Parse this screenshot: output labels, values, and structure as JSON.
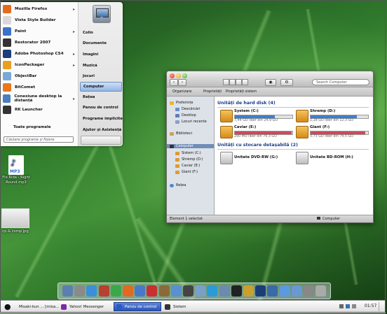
{
  "start_menu": {
    "programs": [
      {
        "label": "Mozilla Firefox",
        "icon": "firefox-icon",
        "color": "#e66a1e",
        "arrow": true
      },
      {
        "label": "Vista Style Builder",
        "icon": "builder-icon",
        "color": "#d9d9d9",
        "arrow": false
      },
      {
        "label": "Paint",
        "icon": "paint-icon",
        "color": "#3a74c9",
        "arrow": true
      },
      {
        "label": "Restorator 2007",
        "icon": "restorator-icon",
        "color": "#333333",
        "arrow": false
      },
      {
        "label": "Adobe Photoshop CS4",
        "icon": "photoshop-icon",
        "color": "#1b3e7a",
        "arrow": true
      },
      {
        "label": "IconPackager",
        "icon": "iconpackager-icon",
        "color": "#e8a020",
        "arrow": true
      },
      {
        "label": "ObjectBar",
        "icon": "objectbar-icon",
        "color": "#7aa8d8",
        "arrow": false
      },
      {
        "label": "BitComet",
        "icon": "bitcomet-icon",
        "color": "#e8781e",
        "arrow": false
      },
      {
        "label": "Conexiune desktop la distanță",
        "icon": "remote-desktop-icon",
        "color": "#4a7fc0",
        "arrow": true
      },
      {
        "label": "RK Launcher",
        "icon": "rklauncher-icon",
        "color": "#333333",
        "arrow": false
      }
    ],
    "all_programs": "Toate programele",
    "search_placeholder": "Căutare programe și fișiere",
    "right_items": [
      "Colin",
      "Documente",
      "Imagini",
      "Muzică",
      "Jocuri",
      "Computer",
      "Rețea",
      "Panou de control",
      "Programe implicite",
      "Ajutor și Asistență"
    ],
    "selected_right": "Computer"
  },
  "explorer": {
    "search_placeholder": "Search Computer",
    "commands": [
      "Organizare",
      "Proprietăți",
      "Proprietăți sistem"
    ],
    "sidebar": {
      "favorites": "Preferințe",
      "favorites_items": [
        "Descărcări",
        "Desktop",
        "Locuri recente"
      ],
      "libraries": "Biblioteci",
      "computer": "Computer",
      "computer_items": [
        "Sistem (C:)",
        "Shremp (D:)",
        "Caviar (E:)",
        "Giant (F:)"
      ],
      "network": "Rețea"
    },
    "hard_disks_header": "Unități de hard disk (4)",
    "drives": [
      {
        "name": "System (C:)",
        "free": "7,44 GO liber din 24,9 GO",
        "used_fraction": 0.7,
        "fill": "#3a7fd0"
      },
      {
        "name": "Shremp (D:)",
        "free": "2,28 GO liber din 12,3 GO",
        "used_fraction": 0.81,
        "fill": "#3a7fd0"
      },
      {
        "name": "Caviar (E:)",
        "free": "290 MO liber din 76,3 GO",
        "used_fraction": 0.99,
        "fill": "#d0485a"
      },
      {
        "name": "Giant (F:)",
        "free": "3,73 GO liber din 74,5 GO",
        "used_fraction": 0.95,
        "fill": "#d0485a"
      }
    ],
    "removable_header": "Unități cu stocare detașabilă (2)",
    "removables": [
      {
        "name": "Unitate DVD-RW (G:)"
      },
      {
        "name": "Unitate BD-ROM (H:)"
      }
    ],
    "status_left": "Element 1 selectat",
    "status_right": "Computer"
  },
  "desktop": {
    "icons": [
      {
        "label": "Flo Rida - Right Round.mp3",
        "badge": "MP3"
      },
      {
        "label": "cp & comp.jpg"
      }
    ]
  },
  "dock": {
    "icons": [
      "finder-icon",
      "activity-icon",
      "safari-icon",
      "scissors-icon",
      "messenger-icon",
      "firefox-icon",
      "itunes-icon",
      "ical-icon",
      "addressbook-icon",
      "mail-icon",
      "dictionary-icon",
      "camera-icon",
      "skype-icon",
      "preview-icon",
      "terminal-icon",
      "font-icon",
      "photoshop-icon",
      "network-icon",
      "downloads-icon",
      "folder-icon",
      "stack-icon",
      "trash-icon"
    ]
  },
  "taskbar": {
    "items": [
      {
        "label": "Misaki-kun ... [misa...",
        "active": false
      },
      {
        "label": "Yahoo! Messenger",
        "active": false
      },
      {
        "label": "Panou de control",
        "active": true
      },
      {
        "label": "Sistem",
        "active": false
      }
    ],
    "clock": "01:57"
  }
}
